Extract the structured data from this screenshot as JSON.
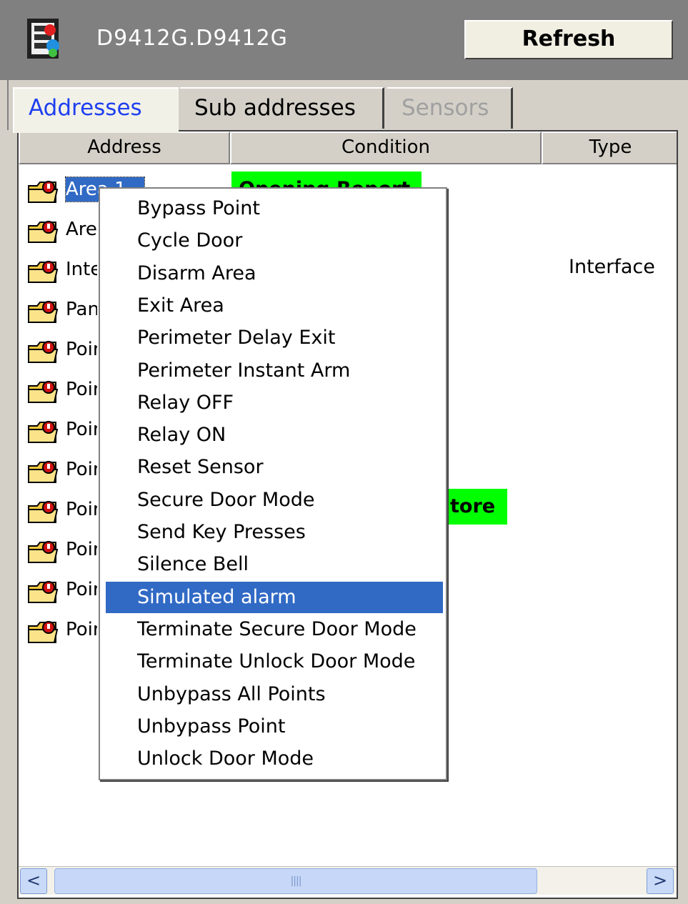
{
  "window": {
    "title": "D9412G.D9412G",
    "refresh_label": "Refresh"
  },
  "tabs": [
    {
      "label": "Addresses",
      "state": "active"
    },
    {
      "label": "Sub addresses",
      "state": "normal"
    },
    {
      "label": "Sensors",
      "state": "disabled"
    }
  ],
  "columns": {
    "address": "Address",
    "condition": "Condition",
    "type": "Type"
  },
  "rows": [
    {
      "address": "Area 1",
      "condition": "Opening Report",
      "type": ""
    },
    {
      "address": "Area",
      "condition": "",
      "type": ""
    },
    {
      "address": "Inte",
      "condition": "",
      "type": "Interface"
    },
    {
      "address": "Pan",
      "condition": "",
      "type": ""
    },
    {
      "address": "Poir",
      "condition": "",
      "type": ""
    },
    {
      "address": "Poir",
      "condition": "",
      "type": ""
    },
    {
      "address": "Poir",
      "condition": "",
      "type": ""
    },
    {
      "address": "Poir",
      "condition": "",
      "type": ""
    },
    {
      "address": "Poir",
      "condition": "tore",
      "type": ""
    },
    {
      "address": "Poir",
      "condition": "",
      "type": ""
    },
    {
      "address": "Poir",
      "condition": "",
      "type": ""
    },
    {
      "address": "Poir",
      "condition": "",
      "type": ""
    }
  ],
  "context_menu": {
    "items": [
      "Bypass Point",
      "Cycle Door",
      "Disarm Area",
      "Exit Area",
      "Perimeter Delay Exit",
      "Perimeter Instant Arm",
      "Relay OFF",
      "Relay ON",
      "Reset Sensor",
      "Secure Door Mode",
      "Send Key Presses",
      "Silence Bell",
      "Simulated alarm",
      "Terminate Secure Door Mode",
      "Terminate Unlock Door Mode",
      "Unbypass All Points",
      "Unbypass Point",
      "Unlock Door Mode"
    ],
    "highlighted": "Simulated alarm"
  },
  "scrollbar": {
    "left_arrow": "<",
    "right_arrow": ">",
    "grip": "||||"
  },
  "colors": {
    "selection": "#316ac5",
    "status_green": "#00ff00",
    "title_bar": "#808080",
    "active_tab_text": "#1f3ff0"
  },
  "icons": {
    "app": "security-panel-icon",
    "row": "folder-alarm-icon"
  }
}
